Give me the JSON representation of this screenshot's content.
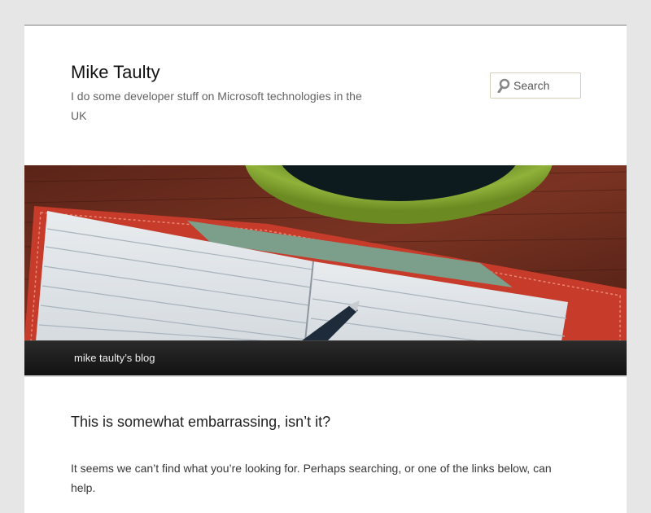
{
  "site": {
    "title": "Mike Taulty",
    "description": "I do some developer stuff on Microsoft technologies in the UK"
  },
  "search": {
    "placeholder": "Search"
  },
  "header_image": {
    "icon": "notebook-and-cup-photo"
  },
  "nav": {
    "items": [
      {
        "label": "mike taulty’s blog"
      }
    ]
  },
  "main": {
    "title": "This is somewhat embarrassing, isn’t it?",
    "body": "It seems we can’t find what you’re looking for. Perhaps searching, or one of the links below, can help."
  },
  "colors": {
    "background": "#e6e6e6",
    "page": "#ffffff",
    "nav": "#1a1a1a"
  }
}
